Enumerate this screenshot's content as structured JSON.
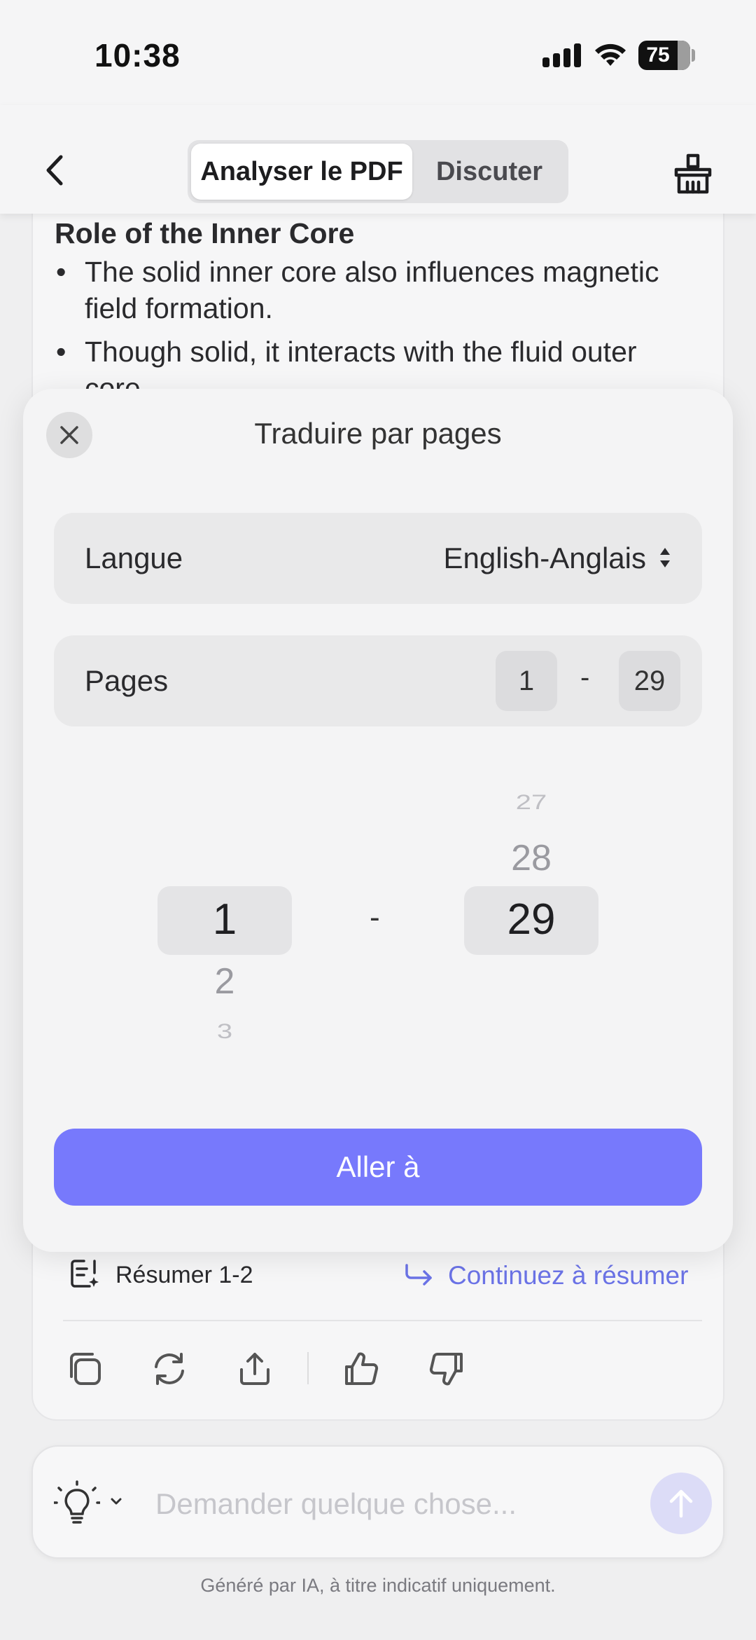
{
  "status_bar": {
    "time": "10:38",
    "battery": "75"
  },
  "header": {
    "tabs": [
      {
        "label": "Analyser le PDF",
        "active": true
      },
      {
        "label": "Discuter",
        "active": false
      }
    ]
  },
  "document": {
    "heading": "Role of the Inner Core",
    "bullets": [
      "The solid inner core also influences magnetic field formation.",
      "Though solid, it interacts with the fluid outer core."
    ]
  },
  "modal": {
    "title": "Traduire par pages",
    "language": {
      "label": "Langue",
      "value": "English-Anglais"
    },
    "pages": {
      "label": "Pages",
      "from": "1",
      "separator": "-",
      "to": "29"
    },
    "picker": {
      "left": {
        "selected": "1",
        "below": [
          "2",
          "3"
        ]
      },
      "separator": "-",
      "right": {
        "selected": "29",
        "above": [
          "27",
          "28"
        ]
      }
    },
    "go_button": "Aller à"
  },
  "summary": {
    "resume_label": "Résumer 1-2",
    "continue_label": "Continuez à résumer"
  },
  "input": {
    "placeholder": "Demander quelque chose..."
  },
  "footer_note": "Généré par IA, à titre indicatif uniquement.",
  "colors": {
    "accent": "#7779fc",
    "link": "#6b73e6",
    "background": "#efeff0"
  }
}
